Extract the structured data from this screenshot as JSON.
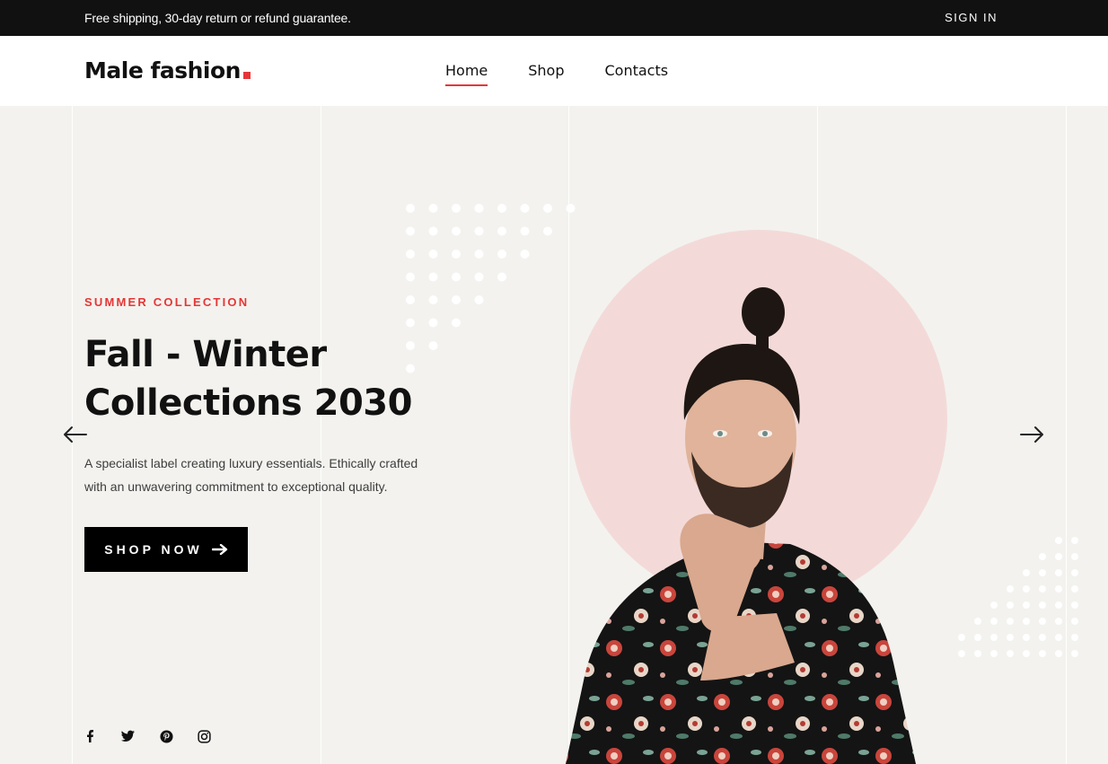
{
  "topbar": {
    "notice": "Free shipping, 30-day return or refund guarantee.",
    "sign_in": "SIGN IN"
  },
  "header": {
    "logo_text": "Male fashion",
    "nav": [
      {
        "label": "Home",
        "active": true
      },
      {
        "label": "Shop",
        "active": false
      },
      {
        "label": "Contacts",
        "active": false
      }
    ]
  },
  "hero": {
    "subtitle": "SUMMER COLLECTION",
    "title_line1": "Fall - Winter",
    "title_line2": "Collections 2030",
    "description_line1": "A specialist label creating luxury essentials. Ethically crafted",
    "description_line2": "with an unwavering commitment to exceptional quality.",
    "cta_label": "SHOP NOW",
    "cta_icon": "arrow-right-icon",
    "prev_icon": "arrow-left-icon",
    "next_icon": "arrow-right-icon"
  },
  "socials": [
    {
      "icon": "facebook-icon"
    },
    {
      "icon": "twitter-icon"
    },
    {
      "icon": "pinterest-icon"
    },
    {
      "icon": "instagram-icon"
    }
  ],
  "colors": {
    "accent": "#e53637",
    "topbar_bg": "#111111",
    "hero_bg": "#f3f2ee",
    "circle": "#f3dad8",
    "button_bg": "#000000"
  }
}
